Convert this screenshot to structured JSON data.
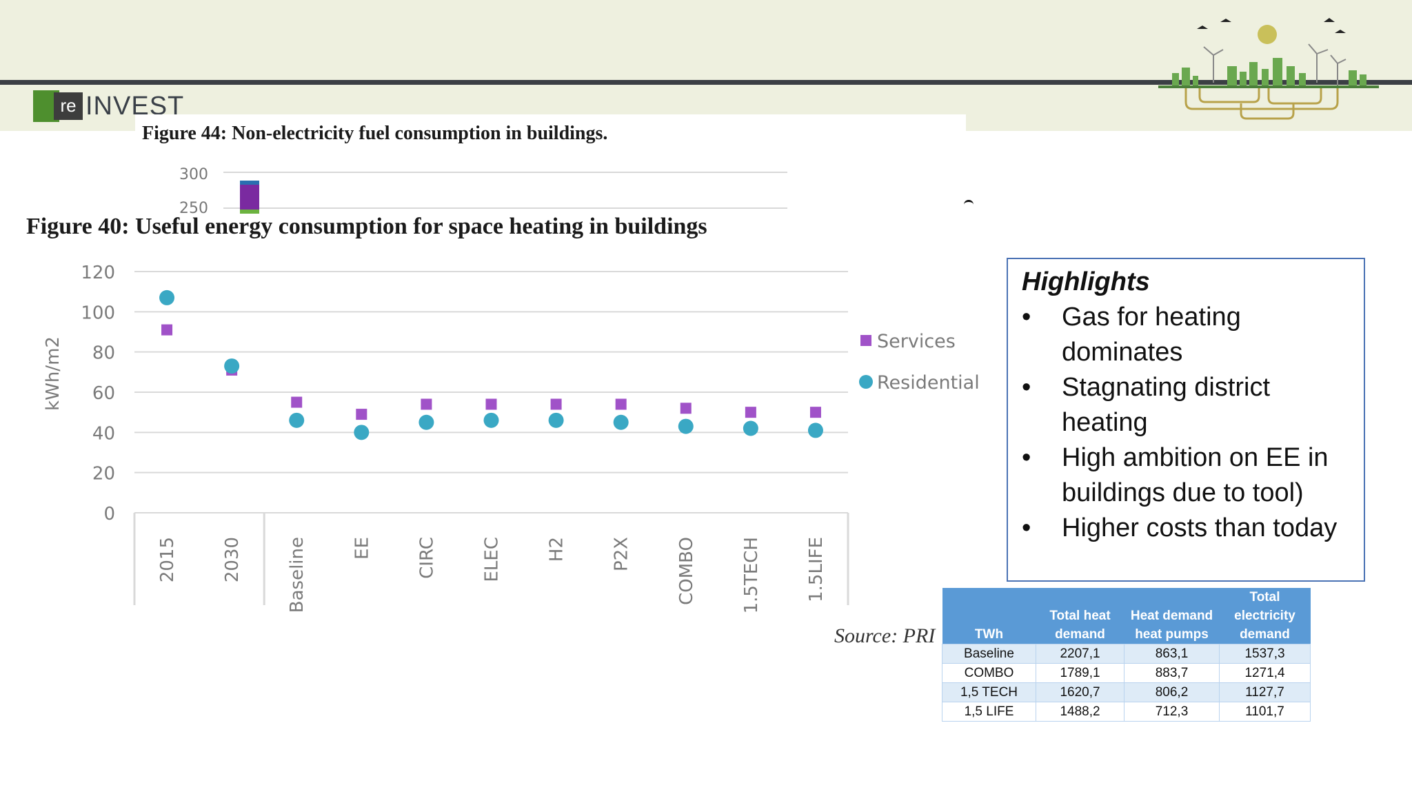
{
  "header": {
    "logo_prefix": "re",
    "logo_name": "INVEST"
  },
  "figure44": {
    "title": "Figure 44: Non-electricity fuel consumption in buildings."
  },
  "figure40": {
    "title": "Figure 40: Useful energy consumption for space heating in buildings"
  },
  "source_text": "Source: PRI",
  "highlights": {
    "title": "Highlights",
    "items": [
      "Gas for heating dominates",
      "Stagnating district heating",
      "High ambition on EE in buildings due to tool)",
      "Higher costs than today"
    ]
  },
  "table": {
    "headers": [
      "TWh",
      "Total heat demand",
      "Heat demand heat pumps",
      "Total electricity demand"
    ],
    "rows": [
      [
        "Baseline",
        "2207,1",
        "863,1",
        "1537,3"
      ],
      [
        "COMBO",
        "1789,1",
        "883,7",
        "1271,4"
      ],
      [
        "1,5 TECH",
        "1620,7",
        "806,2",
        "1127,7"
      ],
      [
        "1,5 LIFE",
        "1488,2",
        "712,3",
        "1101,7"
      ]
    ]
  },
  "colors": {
    "services": "#a052c8",
    "residential": "#3aa8c4",
    "header_band": "#eef0df",
    "table_header": "#5a9ad6"
  },
  "chart_data": [
    {
      "type": "scatter",
      "title": "Figure 40: Useful energy consumption for space heating in buildings",
      "xlabel": "",
      "ylabel": "kWh/m2",
      "ylim": [
        0,
        120
      ],
      "yticks": [
        0,
        20,
        40,
        60,
        80,
        100,
        120
      ],
      "grid": true,
      "legend": "right",
      "categories": [
        "2015",
        "2030",
        "Baseline",
        "EE",
        "CIRC",
        "ELEC",
        "H2",
        "P2X",
        "COMBO",
        "1.5TECH",
        "1.5LIFE"
      ],
      "series": [
        {
          "name": "Services",
          "marker": "square",
          "values": [
            91,
            71,
            55,
            49,
            54,
            54,
            54,
            54,
            52,
            50,
            50
          ]
        },
        {
          "name": "Residential",
          "marker": "circle",
          "values": [
            107,
            73,
            46,
            40,
            45,
            46,
            46,
            45,
            43,
            42,
            41
          ]
        }
      ]
    },
    {
      "type": "bar",
      "title": "Figure 44: Non-electricity fuel consumption in buildings.",
      "yticks_visible": [
        250,
        300
      ],
      "note": ""
    }
  ]
}
